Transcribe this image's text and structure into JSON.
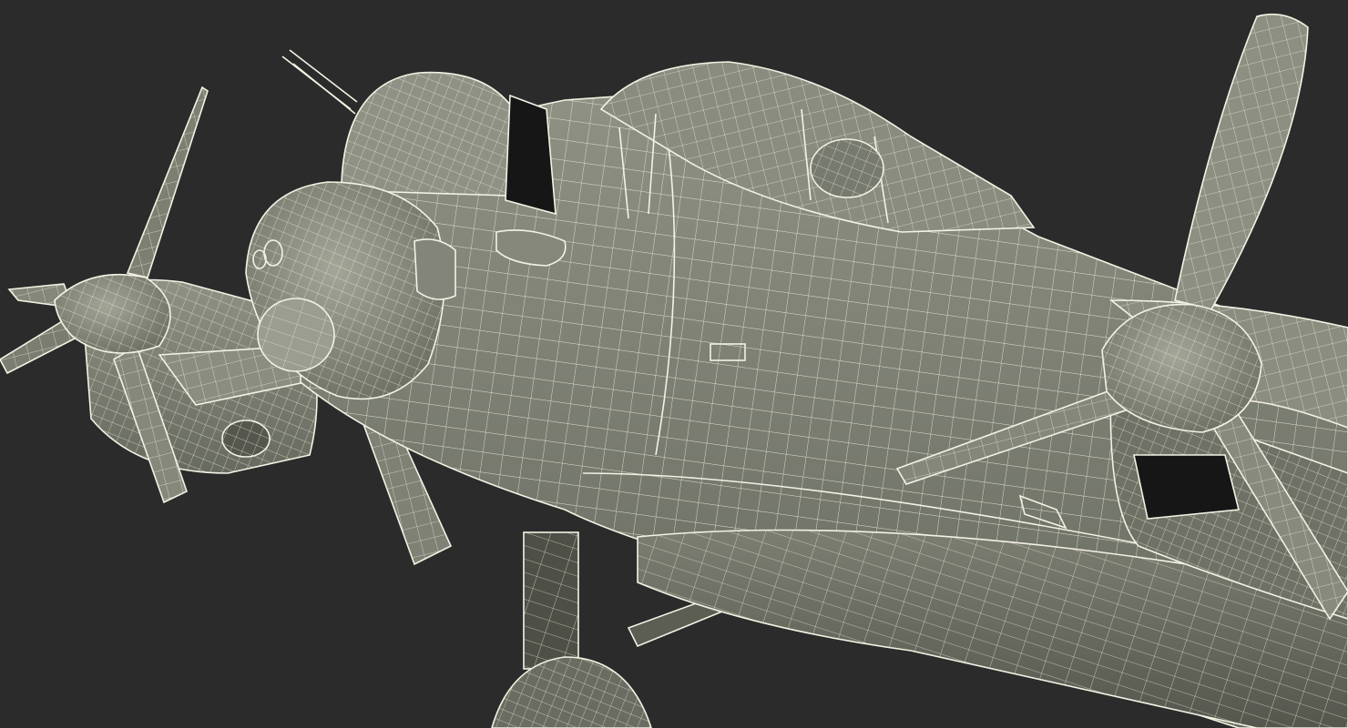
{
  "scene": {
    "subject": "aircraft-wireframe",
    "render_style": "wireframe-over-shaded",
    "colors": {
      "background": "#2b2b2b",
      "surface_light": "#8d8f82",
      "surface_mid": "#6f7166",
      "surface_dark": "#4b4d44",
      "wire": "#ecebd9",
      "cavity": "#161616"
    }
  }
}
